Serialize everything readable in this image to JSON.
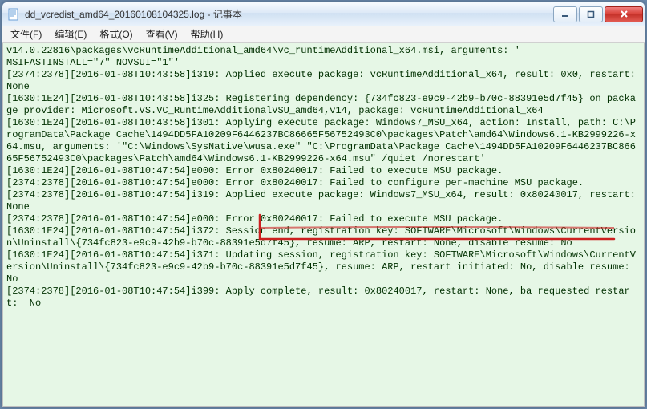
{
  "window": {
    "title": "dd_vcredist_amd64_20160108104325.log - 记事本"
  },
  "menu": {
    "file": "文件(F)",
    "edit": "编辑(E)",
    "format": "格式(O)",
    "view": "查看(V)",
    "help": "帮助(H)"
  },
  "log": {
    "line01": "v14.0.22816\\packages\\vcRuntimeAdditional_amd64\\vc_runtimeAdditional_x64.msi, arguments: '",
    "line02": "MSIFASTINSTALL=\"7\" NOVSUI=\"1\"'",
    "line03": "[2374:2378][2016-01-08T10:43:58]i319: Applied execute package: vcRuntimeAdditional_x64, result: 0x0, restart: None",
    "line04": "[1630:1E24][2016-01-08T10:43:58]i325: Registering dependency: {734fc823-e9c9-42b9-b70c-88391e5d7f45} on package provider: Microsoft.VS.VC_RuntimeAdditionalVSU_amd64,v14, package: vcRuntimeAdditional_x64",
    "line05": "[1630:1E24][2016-01-08T10:43:58]i301: Applying execute package: Windows7_MSU_x64, action: Install, path: C:\\ProgramData\\Package Cache\\1494DD5FA10209F6446237BC86665F56752493C0\\packages\\Patch\\amd64\\Windows6.1-KB2999226-x64.msu, arguments: '\"C:\\Windows\\SysNative\\wusa.exe\" \"C:\\ProgramData\\Package Cache\\1494DD5FA10209F6446237BC86665F56752493C0\\packages\\Patch\\amd64\\Windows6.1-KB2999226-x64.msu\" /quiet /norestart'",
    "line06": "[1630:1E24][2016-01-08T10:47:54]e000: Error 0x80240017: Failed to execute MSU package.",
    "line07": "[2374:2378][2016-01-08T10:47:54]e000: Error 0x80240017: Failed to configure per-machine MSU package.",
    "line08": "[2374:2378][2016-01-08T10:47:54]i319: Applied execute package: Windows7_MSU_x64, result: 0x80240017, restart: None",
    "line09": "[2374:2378][2016-01-08T10:47:54]e000: Error 0x80240017: Failed to execute MSU package.",
    "line10": "[1630:1E24][2016-01-08T10:47:54]i372: Session end, registration key: SOFTWARE\\Microsoft\\Windows\\CurrentVersion\\Uninstall\\{734fc823-e9c9-42b9-b70c-88391e5d7f45}, resume: ARP, restart: None, disable resume: No",
    "line11": "[1630:1E24][2016-01-08T10:47:54]i371: Updating session, registration key: SOFTWARE\\Microsoft\\Windows\\CurrentVersion\\Uninstall\\{734fc823-e9c9-42b9-b70c-88391e5d7f45}, resume: ARP, restart initiated: No, disable resume: No",
    "line12": "[2374:2378][2016-01-08T10:47:54]i399: Apply complete, result: 0x80240017, restart: None, ba requested restart:  No"
  },
  "annotation": {
    "color": "#cc2020"
  }
}
